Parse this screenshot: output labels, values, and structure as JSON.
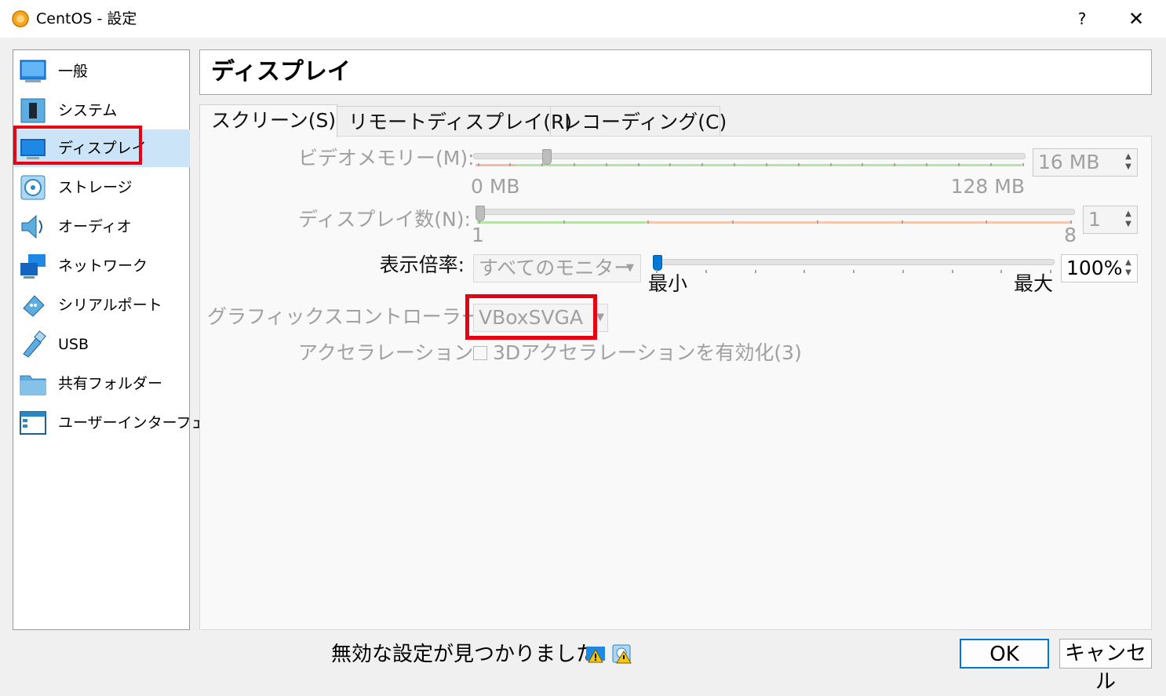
{
  "window": {
    "title": "CentOS - 設定",
    "help_label": "?",
    "close_label": "✕"
  },
  "sidebar": {
    "items": [
      {
        "label": "一般",
        "icon": "monitor-general-icon"
      },
      {
        "label": "システム",
        "icon": "system-chip-icon"
      },
      {
        "label": "ディスプレイ",
        "icon": "display-monitor-icon"
      },
      {
        "label": "ストレージ",
        "icon": "storage-disk-icon"
      },
      {
        "label": "オーディオ",
        "icon": "audio-speaker-icon"
      },
      {
        "label": "ネットワーク",
        "icon": "network-icon"
      },
      {
        "label": "シリアルポート",
        "icon": "serial-port-icon"
      },
      {
        "label": "USB",
        "icon": "usb-icon"
      },
      {
        "label": "共有フォルダー",
        "icon": "shared-folder-icon"
      },
      {
        "label": "ユーザーインターフェース",
        "icon": "user-interface-icon"
      }
    ],
    "selected_index": 2
  },
  "header": {
    "title": "ディスプレイ"
  },
  "tabs": [
    {
      "label": "スクリーン(S)",
      "active": true
    },
    {
      "label": "リモートディスプレイ(R)",
      "active": false
    },
    {
      "label": "レコーディング(C)",
      "active": false
    }
  ],
  "screen": {
    "video_memory": {
      "label": "ビデオメモリー(M):",
      "value": "16 MB",
      "min_label": "0 MB",
      "max_label": "128 MB",
      "level": 0.125
    },
    "display_count": {
      "label": "ディスプレイ数(N):",
      "value": "1",
      "min_label": "1",
      "max_label": "8",
      "level": 0.0
    },
    "scale": {
      "label": "表示倍率:",
      "monitor_option": "すべてのモニター",
      "value": "100%",
      "min_label": "最小",
      "max_label": "最大",
      "level": 0.0
    },
    "graphics_controller": {
      "label": "グラフィックスコントローラー(G):",
      "value": "VBoxSVGA"
    },
    "acceleration": {
      "label": "アクセラレーション:",
      "checkbox_label": "3Dアクセラレーションを有効化(3)",
      "checked": false
    }
  },
  "footer": {
    "warning_text": "無効な設定が見つかりました",
    "ok_label": "OK",
    "cancel_label": "キャンセル"
  },
  "colors": {
    "highlight_red": "#e60012",
    "selected_bg": "#cce4f7",
    "accent_blue": "#0078d7"
  }
}
